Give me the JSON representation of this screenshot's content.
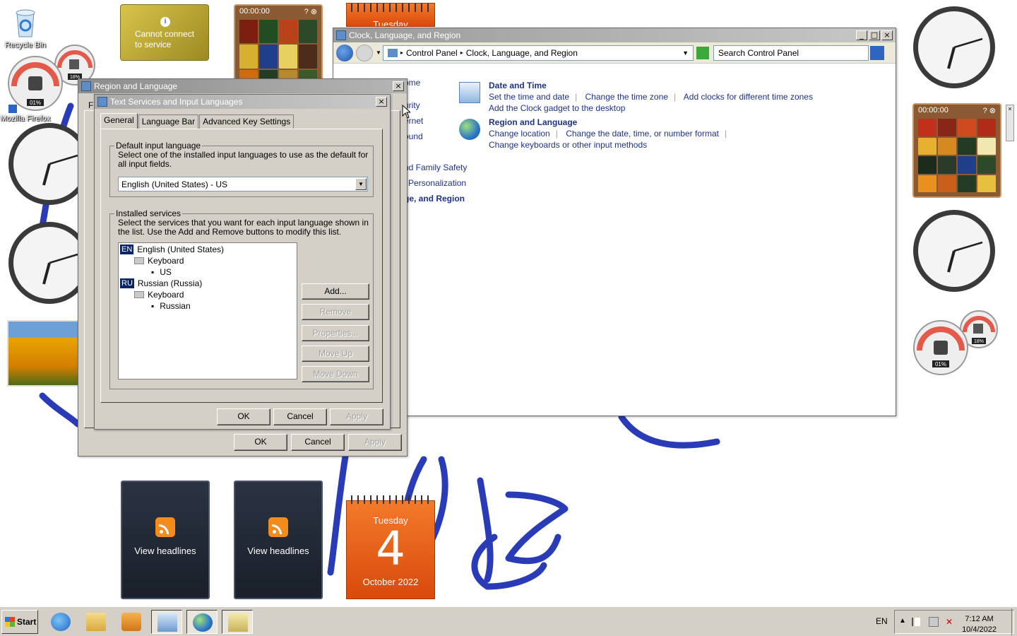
{
  "desktop": {
    "icons": [
      {
        "label": "Recycle Bin"
      },
      {
        "label": "Mozilla Firefox"
      }
    ],
    "weather": {
      "line1": "Cannot connect",
      "line2": "to service"
    },
    "puzzle_timer": "00:00:00",
    "calendar": {
      "weekday": "Tuesday",
      "day": "4",
      "month_year": "October 2022"
    },
    "calendar_top_weekday": "Tuesday",
    "feeds": [
      {
        "label": "View headlines"
      },
      {
        "label": "View headlines"
      }
    ],
    "meters": [
      {
        "cpu": "01%",
        "ram": "18%"
      },
      {
        "cpu": "01%",
        "ram": "18%"
      }
    ]
  },
  "control_panel": {
    "title": "Clock, Language, and Region",
    "breadcrumb": [
      "Control Panel",
      "Clock, Language, and Region"
    ],
    "search_placeholder": "Search Control Panel",
    "left_nav": [
      "ome",
      "urity",
      "ernet",
      "ound",
      "nd Family Safety",
      "l Personalization",
      "ge, and Region"
    ],
    "sections": [
      {
        "heading": "Date and Time",
        "links": [
          "Set the time and date",
          "Change the time zone",
          "Add clocks for different time zones"
        ],
        "links2": [
          "Add the Clock gadget to the desktop"
        ]
      },
      {
        "heading": "Region and Language",
        "links": [
          "Change location",
          "Change the date, time, or number format"
        ],
        "links2": [
          "Change keyboards or other input methods"
        ]
      }
    ]
  },
  "region_dialog": {
    "title": "Region and Language",
    "hidden_tab_letter": "F",
    "ok": "OK",
    "cancel": "Cancel",
    "apply": "Apply"
  },
  "tsil_dialog": {
    "title": "Text Services and Input Languages",
    "tabs": [
      "General",
      "Language Bar",
      "Advanced Key Settings"
    ],
    "default_group": {
      "legend": "Default input language",
      "description": "Select one of the installed input languages to use as the default for all input fields.",
      "selected": "English (United States) - US"
    },
    "services_group": {
      "legend": "Installed services",
      "description": "Select the services that you want for each input language shown in the list. Use the Add and Remove buttons to modify this list.",
      "tree": [
        {
          "badge": "EN",
          "language": "English (United States)",
          "category": "Keyboard",
          "layout": "US"
        },
        {
          "badge": "RU",
          "language": "Russian (Russia)",
          "category": "Keyboard",
          "layout": "Russian"
        }
      ],
      "buttons": {
        "add": "Add...",
        "remove": "Remove",
        "properties": "Properties...",
        "move_up": "Move Up",
        "move_down": "Move Down"
      }
    },
    "ok": "OK",
    "cancel": "Cancel",
    "apply": "Apply"
  },
  "taskbar": {
    "start_label": "Start",
    "language": "EN",
    "time": "7:12 AM",
    "date": "10/4/2022"
  }
}
